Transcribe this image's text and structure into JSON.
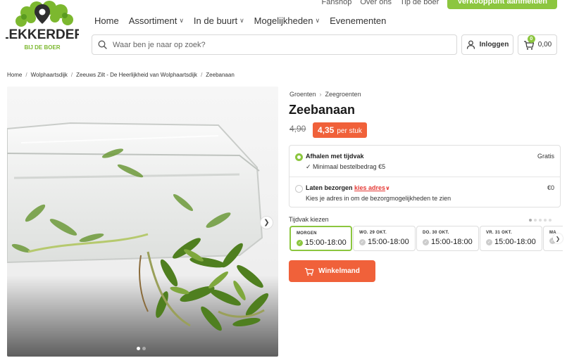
{
  "topbar": {
    "links": [
      "Fanshop",
      "Over ons",
      "Tip de boer"
    ],
    "cta": "Verkooppunt aanmelden"
  },
  "logo": {
    "name": "LEKKERDER",
    "tagline": "BIJ DE BOER"
  },
  "nav": [
    {
      "label": "Home",
      "dropdown": false
    },
    {
      "label": "Assortiment",
      "dropdown": true
    },
    {
      "label": "In de buurt",
      "dropdown": true
    },
    {
      "label": "Mogelijkheden",
      "dropdown": true
    },
    {
      "label": "Evenementen",
      "dropdown": false
    }
  ],
  "search": {
    "placeholder": "Waar ben je naar op zoek?",
    "value": ""
  },
  "account": {
    "login_label": "Inloggen"
  },
  "cart": {
    "count": "0",
    "total": "0,00"
  },
  "breadcrumb": [
    "Home",
    "Wolphaartsdijk",
    "Zeeuws Zilt - De Heerlijkheid van Wolphaartsdijk",
    "Zeebanaan"
  ],
  "product": {
    "category": "Groenten",
    "subcategory": "Zeegroenten",
    "title": "Zeebanaan",
    "old_price": "4,90",
    "price": "4,35",
    "unit": "per stuk"
  },
  "delivery": {
    "pickup": {
      "label": "Afhalen met tijdvak",
      "sub": "✓  Minimaal bestelbedrag €5",
      "fee": "Gratis"
    },
    "ship": {
      "label": "Laten bezorgen",
      "link": "kies adres",
      "sub": "Kies je adres in om de bezorgmogelijkheden te zien",
      "fee": "€0"
    }
  },
  "tijdvak": {
    "label": "Tijdvak kiezen",
    "slots": [
      {
        "day": "MORGEN",
        "time": "15:00-18:00"
      },
      {
        "day": "WO. 29 OKT.",
        "time": "15:00-18:00"
      },
      {
        "day": "DO. 30 OKT.",
        "time": "15:00-18:00"
      },
      {
        "day": "VR. 31 OKT.",
        "time": "15:00-18:00"
      },
      {
        "day": "MA",
        "time": ""
      }
    ]
  },
  "add_to_cart": "Winkelmand",
  "colors": {
    "brand_green": "#8cc63f",
    "accent_orange": "#f0613a",
    "link_red": "#e53935"
  }
}
